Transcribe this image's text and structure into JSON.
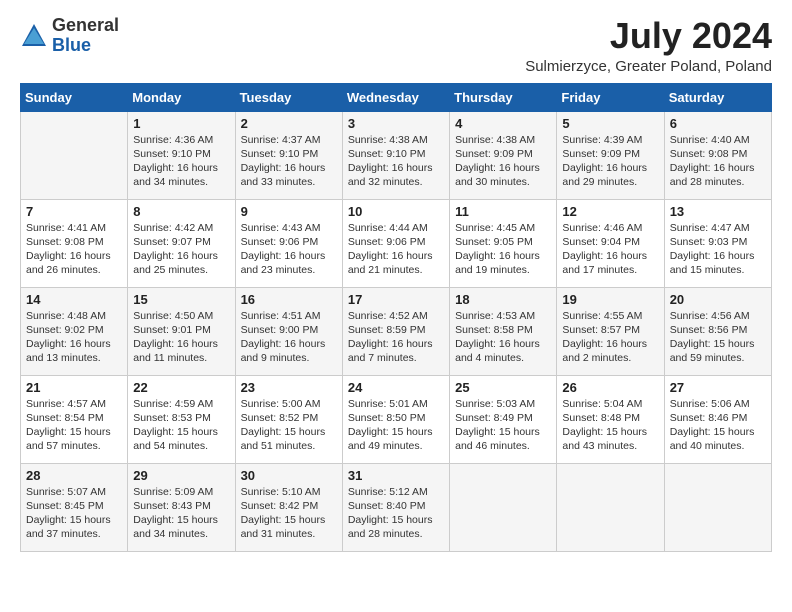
{
  "header": {
    "logo_general": "General",
    "logo_blue": "Blue",
    "title": "July 2024",
    "location": "Sulmierzyce, Greater Poland, Poland"
  },
  "calendar": {
    "days_of_week": [
      "Sunday",
      "Monday",
      "Tuesday",
      "Wednesday",
      "Thursday",
      "Friday",
      "Saturday"
    ],
    "weeks": [
      [
        {
          "day": "",
          "info": ""
        },
        {
          "day": "1",
          "info": "Sunrise: 4:36 AM\nSunset: 9:10 PM\nDaylight: 16 hours\nand 34 minutes."
        },
        {
          "day": "2",
          "info": "Sunrise: 4:37 AM\nSunset: 9:10 PM\nDaylight: 16 hours\nand 33 minutes."
        },
        {
          "day": "3",
          "info": "Sunrise: 4:38 AM\nSunset: 9:10 PM\nDaylight: 16 hours\nand 32 minutes."
        },
        {
          "day": "4",
          "info": "Sunrise: 4:38 AM\nSunset: 9:09 PM\nDaylight: 16 hours\nand 30 minutes."
        },
        {
          "day": "5",
          "info": "Sunrise: 4:39 AM\nSunset: 9:09 PM\nDaylight: 16 hours\nand 29 minutes."
        },
        {
          "day": "6",
          "info": "Sunrise: 4:40 AM\nSunset: 9:08 PM\nDaylight: 16 hours\nand 28 minutes."
        }
      ],
      [
        {
          "day": "7",
          "info": "Sunrise: 4:41 AM\nSunset: 9:08 PM\nDaylight: 16 hours\nand 26 minutes."
        },
        {
          "day": "8",
          "info": "Sunrise: 4:42 AM\nSunset: 9:07 PM\nDaylight: 16 hours\nand 25 minutes."
        },
        {
          "day": "9",
          "info": "Sunrise: 4:43 AM\nSunset: 9:06 PM\nDaylight: 16 hours\nand 23 minutes."
        },
        {
          "day": "10",
          "info": "Sunrise: 4:44 AM\nSunset: 9:06 PM\nDaylight: 16 hours\nand 21 minutes."
        },
        {
          "day": "11",
          "info": "Sunrise: 4:45 AM\nSunset: 9:05 PM\nDaylight: 16 hours\nand 19 minutes."
        },
        {
          "day": "12",
          "info": "Sunrise: 4:46 AM\nSunset: 9:04 PM\nDaylight: 16 hours\nand 17 minutes."
        },
        {
          "day": "13",
          "info": "Sunrise: 4:47 AM\nSunset: 9:03 PM\nDaylight: 16 hours\nand 15 minutes."
        }
      ],
      [
        {
          "day": "14",
          "info": "Sunrise: 4:48 AM\nSunset: 9:02 PM\nDaylight: 16 hours\nand 13 minutes."
        },
        {
          "day": "15",
          "info": "Sunrise: 4:50 AM\nSunset: 9:01 PM\nDaylight: 16 hours\nand 11 minutes."
        },
        {
          "day": "16",
          "info": "Sunrise: 4:51 AM\nSunset: 9:00 PM\nDaylight: 16 hours\nand 9 minutes."
        },
        {
          "day": "17",
          "info": "Sunrise: 4:52 AM\nSunset: 8:59 PM\nDaylight: 16 hours\nand 7 minutes."
        },
        {
          "day": "18",
          "info": "Sunrise: 4:53 AM\nSunset: 8:58 PM\nDaylight: 16 hours\nand 4 minutes."
        },
        {
          "day": "19",
          "info": "Sunrise: 4:55 AM\nSunset: 8:57 PM\nDaylight: 16 hours\nand 2 minutes."
        },
        {
          "day": "20",
          "info": "Sunrise: 4:56 AM\nSunset: 8:56 PM\nDaylight: 15 hours\nand 59 minutes."
        }
      ],
      [
        {
          "day": "21",
          "info": "Sunrise: 4:57 AM\nSunset: 8:54 PM\nDaylight: 15 hours\nand 57 minutes."
        },
        {
          "day": "22",
          "info": "Sunrise: 4:59 AM\nSunset: 8:53 PM\nDaylight: 15 hours\nand 54 minutes."
        },
        {
          "day": "23",
          "info": "Sunrise: 5:00 AM\nSunset: 8:52 PM\nDaylight: 15 hours\nand 51 minutes."
        },
        {
          "day": "24",
          "info": "Sunrise: 5:01 AM\nSunset: 8:50 PM\nDaylight: 15 hours\nand 49 minutes."
        },
        {
          "day": "25",
          "info": "Sunrise: 5:03 AM\nSunset: 8:49 PM\nDaylight: 15 hours\nand 46 minutes."
        },
        {
          "day": "26",
          "info": "Sunrise: 5:04 AM\nSunset: 8:48 PM\nDaylight: 15 hours\nand 43 minutes."
        },
        {
          "day": "27",
          "info": "Sunrise: 5:06 AM\nSunset: 8:46 PM\nDaylight: 15 hours\nand 40 minutes."
        }
      ],
      [
        {
          "day": "28",
          "info": "Sunrise: 5:07 AM\nSunset: 8:45 PM\nDaylight: 15 hours\nand 37 minutes."
        },
        {
          "day": "29",
          "info": "Sunrise: 5:09 AM\nSunset: 8:43 PM\nDaylight: 15 hours\nand 34 minutes."
        },
        {
          "day": "30",
          "info": "Sunrise: 5:10 AM\nSunset: 8:42 PM\nDaylight: 15 hours\nand 31 minutes."
        },
        {
          "day": "31",
          "info": "Sunrise: 5:12 AM\nSunset: 8:40 PM\nDaylight: 15 hours\nand 28 minutes."
        },
        {
          "day": "",
          "info": ""
        },
        {
          "day": "",
          "info": ""
        },
        {
          "day": "",
          "info": ""
        }
      ]
    ]
  }
}
